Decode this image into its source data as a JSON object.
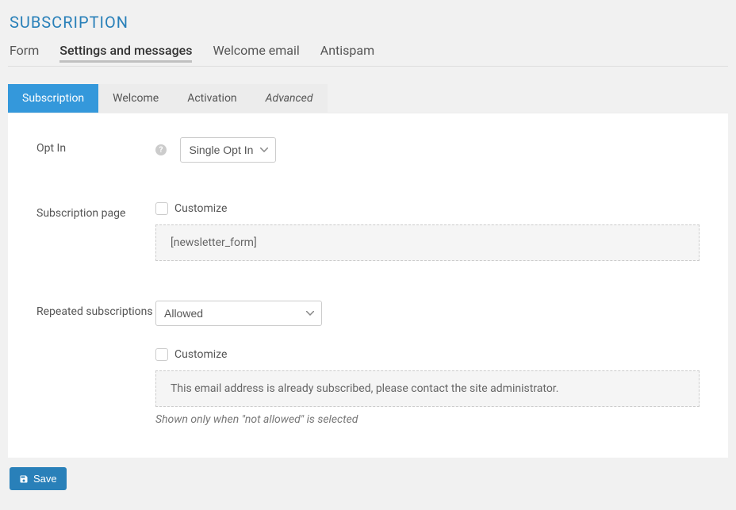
{
  "page_title": "SUBSCRIPTION",
  "main_nav": {
    "items": [
      "Form",
      "Settings and messages",
      "Welcome email",
      "Antispam"
    ],
    "active_index": 1
  },
  "sub_tabs": {
    "items": [
      "Subscription",
      "Welcome",
      "Activation",
      "Advanced"
    ],
    "active_index": 0
  },
  "form": {
    "optin": {
      "label": "Opt In",
      "value": "Single Opt In",
      "options": [
        "Single Opt In"
      ]
    },
    "subscription_page": {
      "label": "Subscription page",
      "customize_label": "Customize",
      "shortcode": "[newsletter_form]"
    },
    "repeated": {
      "label": "Repeated subscriptions",
      "value": "Allowed",
      "options": [
        "Allowed"
      ],
      "customize_label": "Customize",
      "message": "This email address is already subscribed, please contact the site administrator.",
      "hint": "Shown only when \"not allowed\" is selected"
    }
  },
  "footer": {
    "save_label": "Save"
  }
}
